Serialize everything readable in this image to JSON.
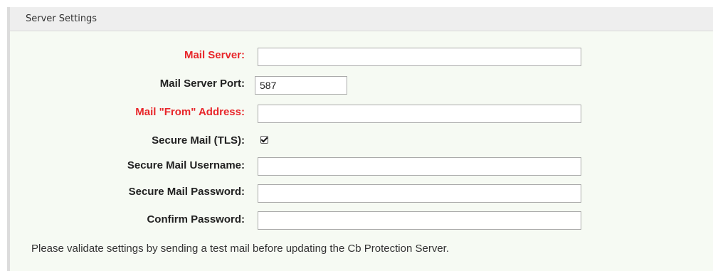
{
  "panel": {
    "title": "Server Settings"
  },
  "form": {
    "mail_server": {
      "label": "Mail Server:",
      "value": ""
    },
    "mail_server_port": {
      "label": "Mail Server Port:",
      "value": "587"
    },
    "mail_from_address": {
      "label": "Mail \"From\" Address:",
      "value": ""
    },
    "secure_mail_tls": {
      "label": "Secure Mail (TLS):",
      "checked": true
    },
    "secure_mail_username": {
      "label": "Secure Mail Username:",
      "value": ""
    },
    "secure_mail_password": {
      "label": "Secure Mail Password:",
      "value": ""
    },
    "confirm_password": {
      "label": "Confirm Password:",
      "value": ""
    }
  },
  "note": "Please validate settings by sending a test mail before updating the Cb Protection Server.",
  "colors": {
    "required_label": "#e8262a",
    "panel_background": "#f6faf3",
    "header_background": "#eeeeee"
  }
}
